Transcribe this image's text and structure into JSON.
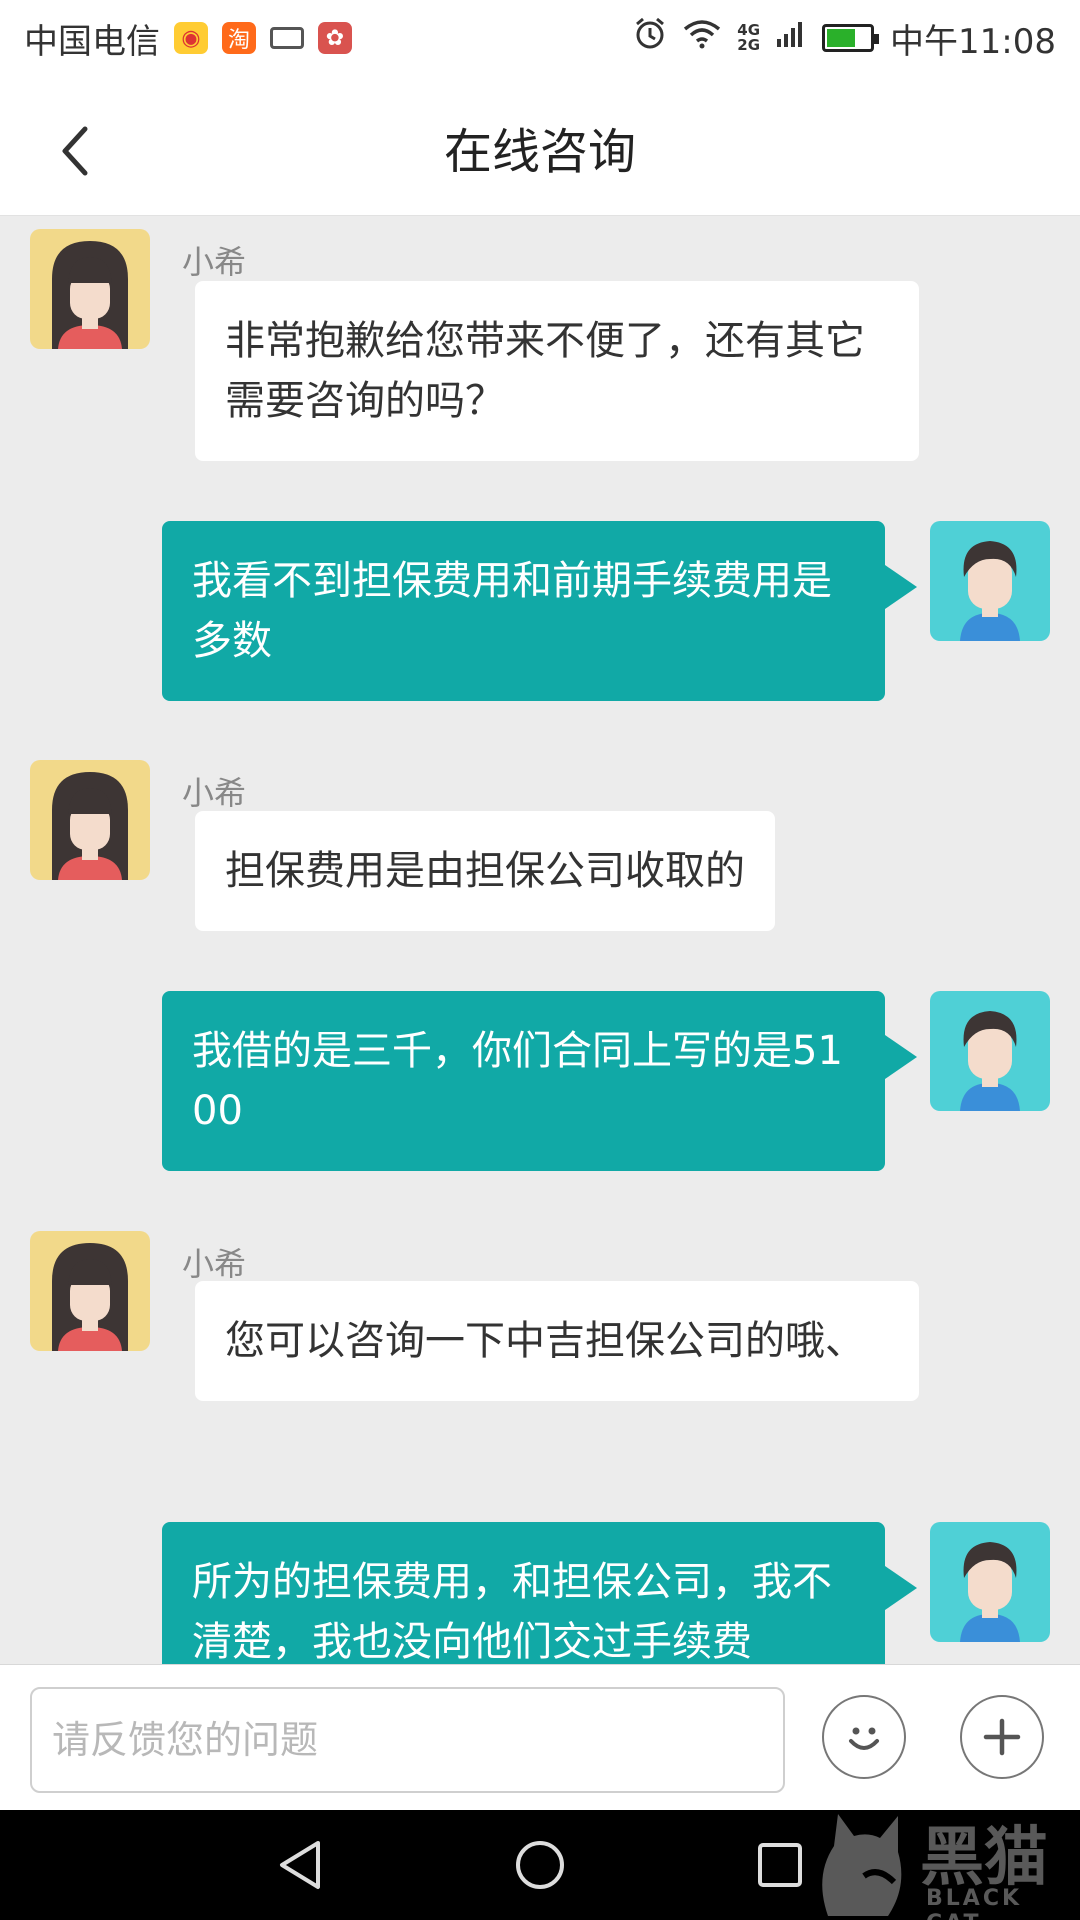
{
  "status_bar": {
    "carrier": "中国电信",
    "net_top": "4G",
    "net_bottom": "2G",
    "time": "中午11:08",
    "app_icons": [
      "weibo-icon",
      "taobao-icon",
      "keyboard-icon",
      "huawei-icon"
    ],
    "battery_color": "#2ab02a"
  },
  "header": {
    "title": "在线咨询",
    "back_icon": "chevron-left-icon"
  },
  "messages": [
    {
      "from": "agent",
      "name": "小希",
      "text": "非常抱歉给您带来不便了，还有其它需要咨询的吗？"
    },
    {
      "from": "user",
      "text": "我看不到担保费用和前期手续费用是多数"
    },
    {
      "from": "agent",
      "name": "小希",
      "text": "担保费用是由担保公司收取的"
    },
    {
      "from": "user",
      "text": "我借的是三千，你们合同上写的是5100"
    },
    {
      "from": "agent",
      "name": "小希",
      "text": "您可以咨询一下中吉担保公司的哦、"
    },
    {
      "from": "user",
      "text": "所为的担保费用，和担保公司，我不清楚，我也没向他们交过手续费"
    }
  ],
  "input": {
    "placeholder": "请反馈您的问题",
    "value": ""
  },
  "watermark": {
    "text": "黑猫",
    "sub": "BLACK CAT"
  },
  "colors": {
    "user_bubble": "#11a9a6",
    "agent_bubble": "#ffffff",
    "chat_bg": "#ececec",
    "agent_avatar_bg": "#f2d98a",
    "user_avatar_bg": "#4fd0d6"
  }
}
